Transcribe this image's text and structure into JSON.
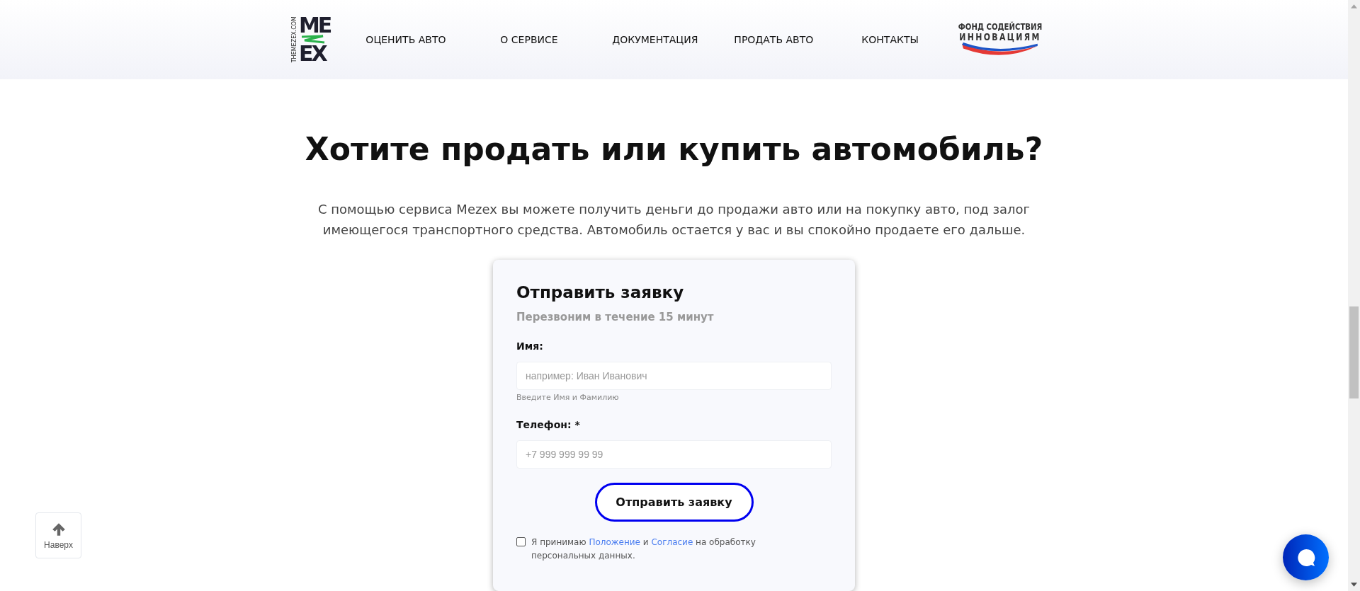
{
  "header": {
    "logo": {
      "side_text": "THEMEZEX.COM",
      "top": "ME",
      "bottom": "EX"
    },
    "nav": [
      {
        "label": "ОЦЕНИТЬ АВТО"
      },
      {
        "label": "О СЕРВИСЕ"
      },
      {
        "label": "ДОКУМЕНТАЦИЯ"
      },
      {
        "label": "ПРОДАТЬ АВТО"
      },
      {
        "label": "КОНТАКТЫ"
      }
    ],
    "partner_logo": {
      "line_1": "ФОНД СОДЕЙСТВИЯ",
      "line_2": "ИННОВАЦИЯМ"
    }
  },
  "hero": {
    "title": "Хотите продать или купить автомобиль?",
    "text": "С помощью сервиса Mezex вы можете получить деньги до продажи авто или на покупку авто, под залог имеющегося транспортного средства. Автомобиль остается у вас и вы спокойно продаете его дальше."
  },
  "form": {
    "title": "Отправить заявку",
    "subtitle": "Перезвоним в течение 15 минут",
    "fields": [
      {
        "label": "Имя:",
        "placeholder": "например: Иван Иванович",
        "hint": "Введите Имя и Фамилию"
      },
      {
        "label": "Телефон: *",
        "placeholder": "+7 999 999 99 99"
      }
    ],
    "submit": "Отправить заявку",
    "consent": {
      "checked": false,
      "text_1": "Я принимаю",
      "link_1": "Положение",
      "text_2": "и",
      "link_2": "Согласие",
      "text_3": "на обработку персональных данных."
    }
  },
  "back_to_top": {
    "label": "Наверх"
  }
}
